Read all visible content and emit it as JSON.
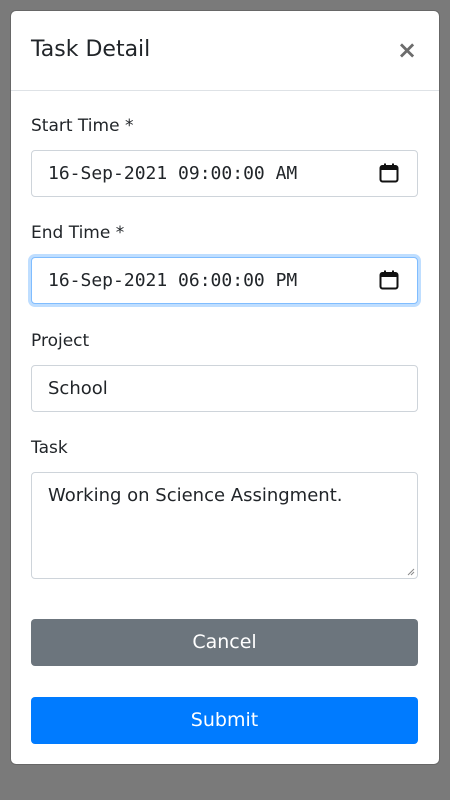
{
  "modal": {
    "title": "Task Detail",
    "close_symbol": "×"
  },
  "fields": {
    "start_time": {
      "label": "Start Time *",
      "value": "16-Sep-2021 09:00:00 AM",
      "icon": "calendar-icon"
    },
    "end_time": {
      "label": "End Time *",
      "value": "16-Sep-2021 06:00:00 PM",
      "icon": "calendar-icon"
    },
    "project": {
      "label": "Project",
      "value": "School"
    },
    "task": {
      "label": "Task",
      "value": "Working on Science Assingment."
    }
  },
  "buttons": {
    "cancel": "Cancel",
    "submit": "Submit"
  },
  "colors": {
    "cancel_bg": "#6c757d",
    "submit_bg": "#007bff",
    "focus_border": "#80bdff",
    "overlay": "#7a7a7a"
  }
}
